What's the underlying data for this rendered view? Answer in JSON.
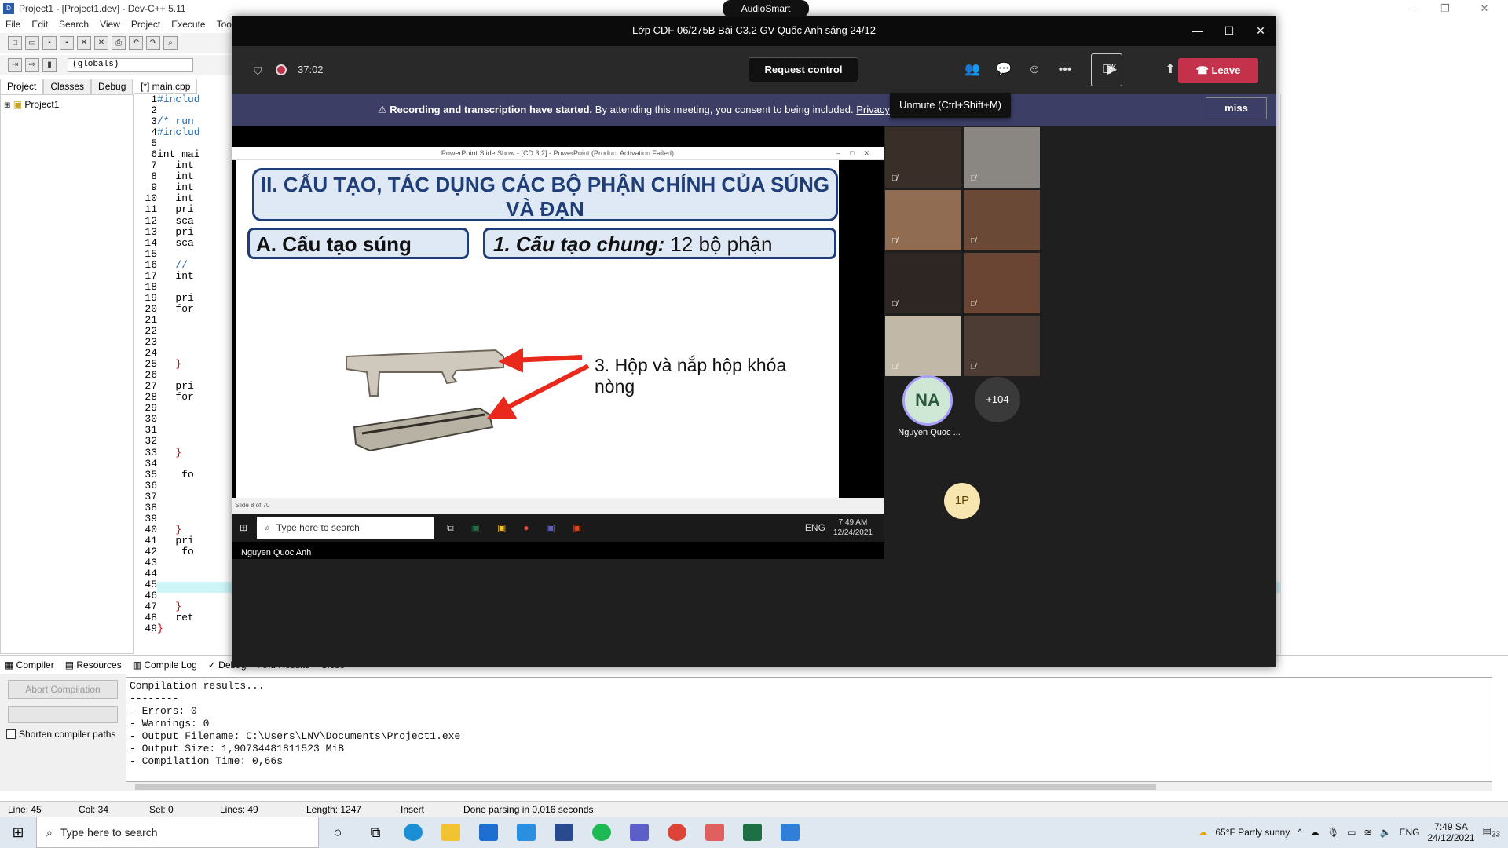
{
  "dev": {
    "title": "Project1 - [Project1.dev] - Dev-C++ 5.11",
    "menu": [
      "File",
      "Edit",
      "Search",
      "View",
      "Project",
      "Execute",
      "Tools"
    ],
    "globals": "(globals)",
    "ptabs": [
      "Project",
      "Classes",
      "Debug"
    ],
    "project_item": "Project1",
    "editor_tab": "[*] main.cpp",
    "line_numbers": [
      "1",
      "2",
      "3",
      "4",
      "5",
      "6",
      "7",
      "8",
      "9",
      "10",
      "11",
      "12",
      "13",
      "14",
      "15",
      "16",
      "17",
      "18",
      "19",
      "20",
      "21",
      "22",
      "23",
      "24",
      "25",
      "26",
      "27",
      "28",
      "29",
      "30",
      "31",
      "32",
      "33",
      "34",
      "35",
      "36",
      "37",
      "38",
      "39",
      "40",
      "41",
      "42",
      "43",
      "44",
      "45",
      "46",
      "47",
      "48",
      "49"
    ],
    "code_lines": [
      "#includ",
      "",
      "/* run",
      "#includ",
      "",
      "int mai",
      "   int",
      "   int",
      "   int",
      "   int",
      "   pri",
      "   sca",
      "   pri",
      "   sca",
      "",
      "   //",
      "   int",
      "",
      "   pri",
      "   for",
      "",
      "",
      "",
      "",
      "   }",
      "",
      "   pri",
      "   for",
      "",
      "",
      "",
      "",
      "   }",
      "",
      "    fo",
      "",
      "",
      "",
      "",
      "   }",
      "   pri",
      "    fo",
      "",
      "",
      "",
      "",
      "   }",
      "   ret",
      "}"
    ],
    "bottom_tabs": [
      "Compiler",
      "Resources",
      "Compile Log",
      "Debug",
      "Find Results",
      "Close"
    ],
    "abort_label": "Abort Compilation",
    "shorten_label": "Shorten compiler paths",
    "log_lines": [
      "Compilation results...",
      "--------",
      "- Errors: 0",
      "- Warnings: 0",
      "- Output Filename: C:\\Users\\LNV\\Documents\\Project1.exe",
      "- Output Size: 1,90734481811523 MiB",
      "- Compilation Time: 0,66s"
    ],
    "status": {
      "line": "Line:    45",
      "col": "Col:    34",
      "sel": "Sel:    0",
      "lines": "Lines:    49",
      "length": "Length: 1247",
      "mode": "Insert",
      "msg": "Done parsing in 0,016 seconds"
    }
  },
  "taskbar": {
    "search_placeholder": "Type here to search",
    "weather": "65°F  Partly sunny",
    "lang": "ENG",
    "time": "7:49 SA",
    "date": "24/12/2021",
    "notif": "23"
  },
  "teams": {
    "audiosmart": "AudioSmart",
    "title": "Lớp CDF 06/275B Bài C3.2 GV Quốc Anh sáng 24/12",
    "timer": "37:02",
    "request_control": "Request control",
    "leave": "Leave",
    "banner_bold": "Recording and transcription have started.",
    "banner_text": "By attending this meeting, you consent to being included.",
    "banner_link": "Privacy policy",
    "dismiss": "miss",
    "tooltip": "Unmute (Ctrl+Shift+M)",
    "presenter": "Nguyen Quoc Anh",
    "avatar_initials": "NA",
    "avatar_name": "Nguyen Quoc ...",
    "more_count": "+104",
    "p1_initials": "1P",
    "colors": {
      "leave": "#c4314b",
      "banner": "#3d3e66",
      "accent": "#a8a0ff"
    }
  },
  "ppt": {
    "window_title": "PowerPoint Slide Show - [CD 3.2] - PowerPoint (Product Activation Failed)",
    "slide_title": "II. CẤU TẠO, TÁC DỤNG CÁC BỘ PHẬN CHÍNH CỦA SÚNG VÀ ĐẠN",
    "box_a": "A. Cấu tạo súng",
    "box_1_bold": "1. Cấu tạo chung:",
    "box_1_text": " 12 bộ phận",
    "part_label": "3. Hộp và nắp hộp khóa nòng",
    "slide_counter": "Slide 8 of 70",
    "inner_search": "Type here to search",
    "inner_lang": "ENG",
    "inner_time": "7:49 AM",
    "inner_date": "12/24/2021"
  }
}
